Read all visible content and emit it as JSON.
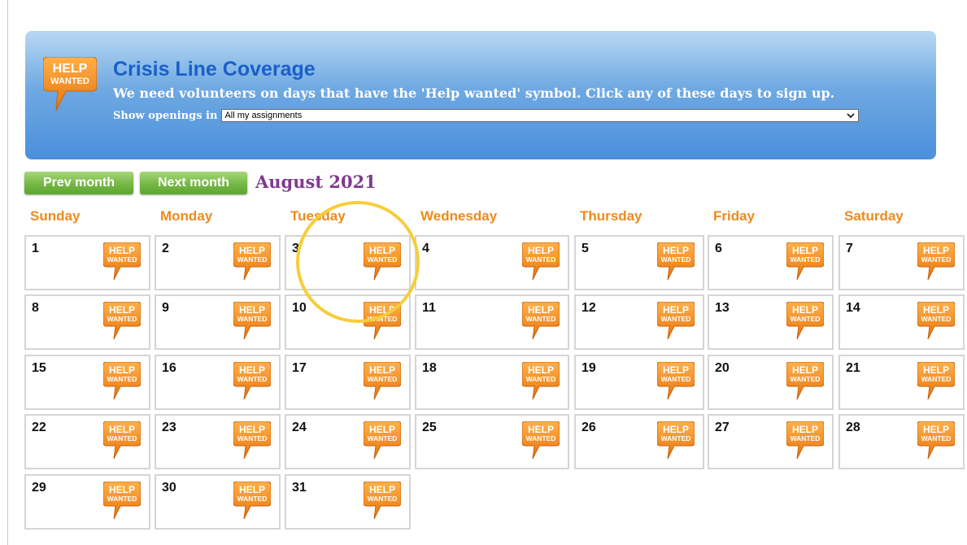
{
  "banner": {
    "badge_line1": "HELP",
    "badge_line2": "WANTED",
    "title": "Crisis Line Coverage",
    "subtitle": "We need volunteers on days that have the 'Help wanted' symbol. Click any of these days to sign up.",
    "filter_label": "Show openings in",
    "filter_value": "All my assignments"
  },
  "nav": {
    "prev_label": "Prev month",
    "next_label": "Next month",
    "month_title": "August 2021"
  },
  "weekdays": [
    "Sunday",
    "Monday",
    "Tuesday",
    "Wednesday",
    "Thursday",
    "Friday",
    "Saturday"
  ],
  "help_badge": {
    "line1": "HELP",
    "line2": "WANTED"
  },
  "days": [
    "1",
    "2",
    "3",
    "4",
    "5",
    "6",
    "7",
    "8",
    "9",
    "10",
    "11",
    "12",
    "13",
    "14",
    "15",
    "16",
    "17",
    "18",
    "19",
    "20",
    "21",
    "22",
    "23",
    "24",
    "25",
    "26",
    "27",
    "28",
    "29",
    "30",
    "31"
  ],
  "colors": {
    "badge_orange": "#f08a1c",
    "nav_green": "#75b844",
    "month_purple": "#7f3a8e",
    "banner_title_blue": "#1a5fc9",
    "highlight_yellow": "#f7cd3a"
  }
}
